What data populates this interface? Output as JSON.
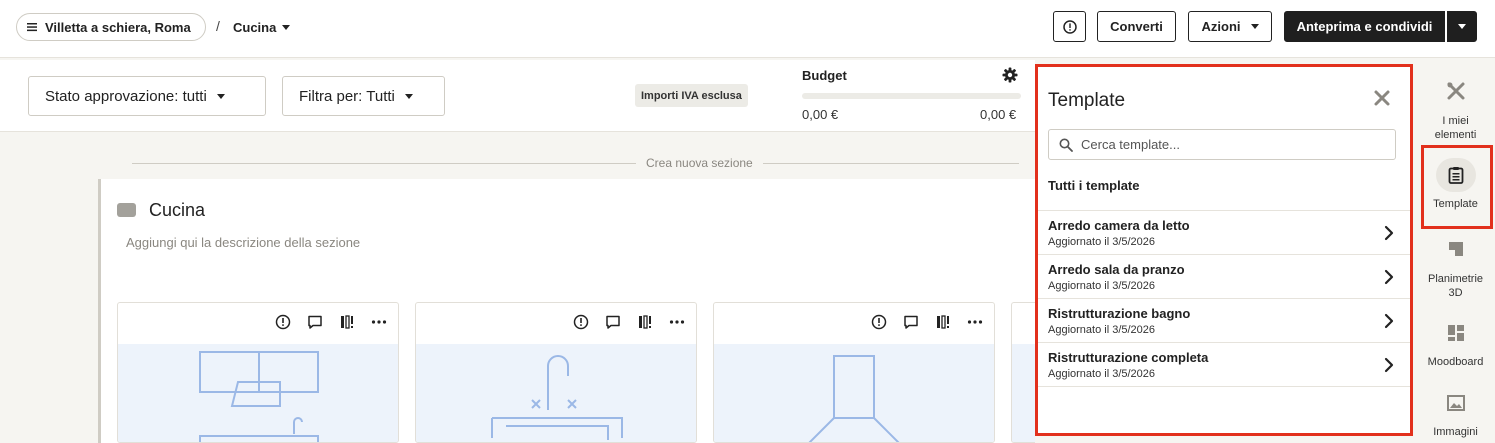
{
  "header": {
    "project_name": "Villetta a schiera, Roma",
    "separator": "/",
    "room_name": "Cucina",
    "convert_label": "Converti",
    "actions_label": "Azioni",
    "preview_share_label": "Anteprima e condividi"
  },
  "filters": {
    "approval_status": "Stato approvazione: tutti",
    "filter_by": "Filtra per: Tutti",
    "vat_badge": "Importi IVA esclusa"
  },
  "budget": {
    "label": "Budget",
    "spent": "0,00 €",
    "total": "0,00 €",
    "progress_fraction": 0
  },
  "content": {
    "new_section_label": "Crea nuova sezione",
    "section_title": "Cucina",
    "section_description": "Aggiungi qui la descrizione della sezione"
  },
  "template_panel": {
    "title": "Template",
    "search_placeholder": "Cerca template...",
    "all_label": "Tutti i template",
    "templates": [
      {
        "name": "Arredo camera da letto",
        "updated": "Aggiornato il 3/5/2026"
      },
      {
        "name": "Arredo sala da pranzo",
        "updated": "Aggiornato il 3/5/2026"
      },
      {
        "name": "Ristrutturazione bagno",
        "updated": "Aggiornato il 3/5/2026"
      },
      {
        "name": "Ristrutturazione completa",
        "updated": "Aggiornato il 3/5/2026"
      }
    ]
  },
  "rail": {
    "items": [
      {
        "label": "I miei elementi",
        "icon": "tools-icon"
      },
      {
        "label": "Template",
        "icon": "clipboard-icon",
        "active": true
      },
      {
        "label": "Planimetrie 3D",
        "icon": "floorplan-icon"
      },
      {
        "label": "Moodboard",
        "icon": "moodboard-icon"
      },
      {
        "label": "Immagini",
        "icon": "image-icon"
      }
    ]
  },
  "colors": {
    "highlight": "#e2301c",
    "primary_button": "#1f1f1f",
    "item_image_bg": "#edf3fb",
    "item_line": "#9bb8e6"
  }
}
